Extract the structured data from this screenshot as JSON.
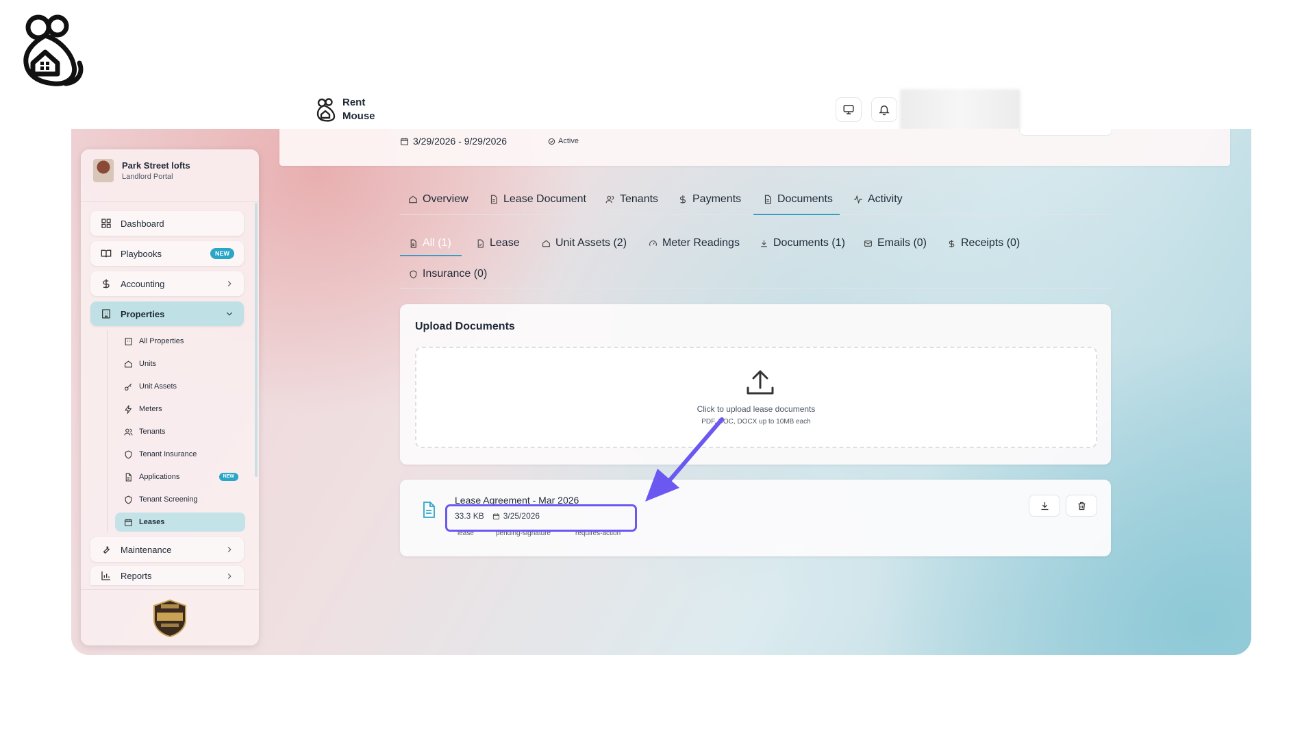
{
  "topbar": {
    "app_name_line1": "Rent",
    "app_name_line2": "Mouse"
  },
  "sidebar": {
    "org_name": "Park Street lofts",
    "org_subtitle": "Landlord Portal",
    "items": [
      {
        "label": "Dashboard",
        "icon": "grid-icon"
      },
      {
        "label": "Playbooks",
        "icon": "book-icon",
        "badge": "NEW"
      },
      {
        "label": "Accounting",
        "icon": "dollar-icon"
      },
      {
        "label": "Properties",
        "icon": "building-icon"
      },
      {
        "label": "Maintenance",
        "icon": "wrench-icon"
      },
      {
        "label": "Reports",
        "icon": "bar-chart-icon"
      }
    ],
    "sub_items": [
      {
        "label": "All Properties",
        "icon": "building-icon"
      },
      {
        "label": "Units",
        "icon": "home-icon"
      },
      {
        "label": "Unit Assets",
        "icon": "key-icon"
      },
      {
        "label": "Meters",
        "icon": "zap-icon"
      },
      {
        "label": "Tenants",
        "icon": "users-icon"
      },
      {
        "label": "Tenant Insurance",
        "icon": "shield-icon"
      },
      {
        "label": "Applications",
        "icon": "file-icon",
        "badge": "NEW"
      },
      {
        "label": "Tenant Screening",
        "icon": "shield-icon"
      },
      {
        "label": "Leases",
        "icon": "calendar-icon"
      }
    ]
  },
  "lease_summary": {
    "dates": "3/29/2026 - 9/29/2026",
    "status": "Active"
  },
  "main_tabs": [
    {
      "label": "Overview",
      "icon": "home-icon"
    },
    {
      "label": "Lease Document",
      "icon": "file-icon"
    },
    {
      "label": "Tenants",
      "icon": "users-icon"
    },
    {
      "label": "Payments",
      "icon": "dollar-icon"
    },
    {
      "label": "Documents",
      "icon": "file-icon"
    },
    {
      "label": "Activity",
      "icon": "activity-icon"
    }
  ],
  "sub_tabs": [
    {
      "label": "All (1)",
      "icon": "file-icon"
    },
    {
      "label": "Lease",
      "icon": "file-icon"
    },
    {
      "label": "Unit Assets (2)",
      "icon": "home-icon"
    },
    {
      "label": "Meter Readings",
      "icon": "gauge-icon"
    },
    {
      "label": "Documents (1)",
      "icon": "download-icon"
    },
    {
      "label": "Emails (0)",
      "icon": "mail-icon"
    },
    {
      "label": "Receipts (0)",
      "icon": "dollar-icon"
    },
    {
      "label": "Insurance (0)",
      "icon": "shield-icon"
    }
  ],
  "upload": {
    "title": "Upload Documents",
    "prompt": "Click to upload lease documents",
    "hint": "PDF, DOC, DOCX up to 10MB each"
  },
  "document": {
    "name": "Lease Agreement - Mar 2026",
    "size": "33.3 KB",
    "date": "3/25/2026",
    "tags": [
      "lease",
      "pending-signature",
      "requires-action"
    ]
  },
  "colors": {
    "accent": "#3a9cc0",
    "badge": "#2aa6c7",
    "highlight": "#6b58f1",
    "active_nav": "#bfe1e6"
  }
}
